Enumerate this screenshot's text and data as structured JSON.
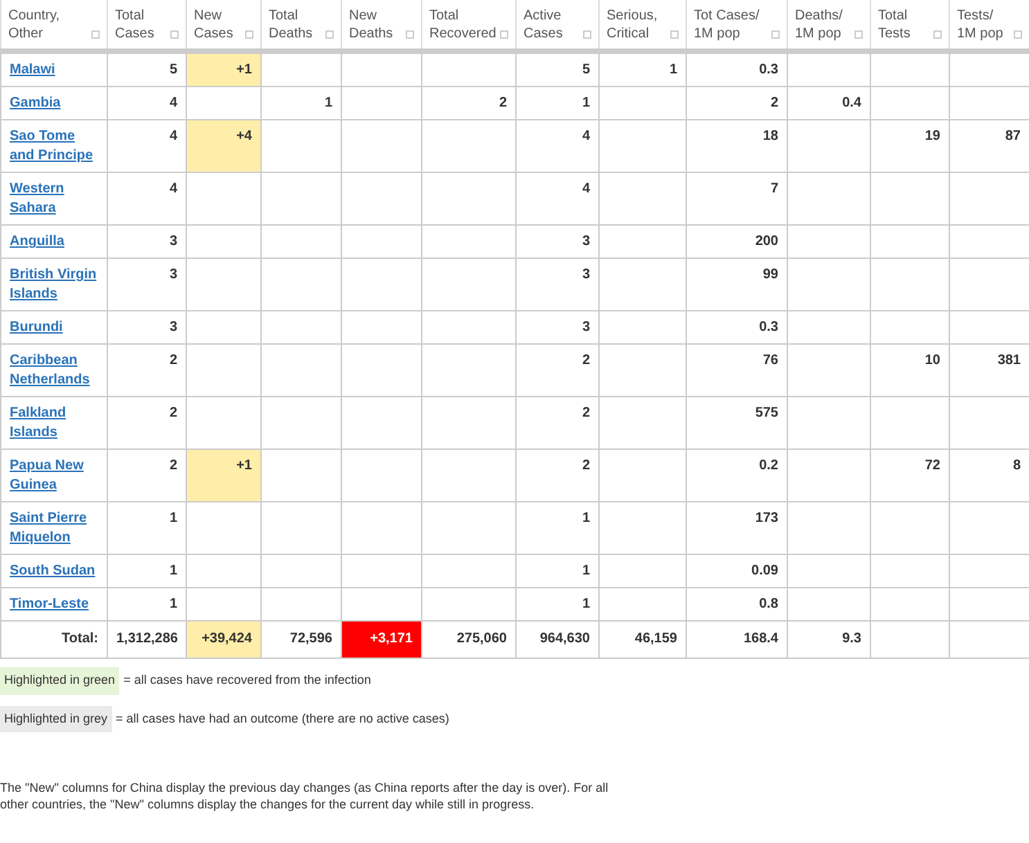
{
  "table": {
    "columns": [
      {
        "label": "Country, Other",
        "kind": "country"
      },
      {
        "label": "Total Cases",
        "kind": "number"
      },
      {
        "label": "New Cases",
        "kind": "new_cases"
      },
      {
        "label": "Total Deaths",
        "kind": "number"
      },
      {
        "label": "New Deaths",
        "kind": "new_deaths"
      },
      {
        "label": "Total Recovered",
        "kind": "number"
      },
      {
        "label": "Active Cases",
        "kind": "number"
      },
      {
        "label": "Serious, Critical",
        "kind": "number"
      },
      {
        "label": "Tot Cases/ 1M pop",
        "kind": "number"
      },
      {
        "label": "Deaths/ 1M pop",
        "kind": "number"
      },
      {
        "label": "Total Tests",
        "kind": "number"
      },
      {
        "label": "Tests/ 1M pop",
        "kind": "number"
      }
    ],
    "rows": [
      {
        "cells": [
          "Malawi",
          "5",
          "+1",
          "",
          "",
          "",
          "5",
          "1",
          "0.3",
          "",
          "",
          ""
        ]
      },
      {
        "cells": [
          "Gambia",
          "4",
          "",
          "1",
          "",
          "2",
          "1",
          "",
          "2",
          "0.4",
          "",
          ""
        ]
      },
      {
        "cells": [
          "Sao Tome and Principe",
          "4",
          "+4",
          "",
          "",
          "",
          "4",
          "",
          "18",
          "",
          "19",
          "87"
        ]
      },
      {
        "cells": [
          "Western Sahara",
          "4",
          "",
          "",
          "",
          "",
          "4",
          "",
          "7",
          "",
          "",
          ""
        ]
      },
      {
        "cells": [
          "Anguilla",
          "3",
          "",
          "",
          "",
          "",
          "3",
          "",
          "200",
          "",
          "",
          ""
        ]
      },
      {
        "cells": [
          "British Virgin Islands",
          "3",
          "",
          "",
          "",
          "",
          "3",
          "",
          "99",
          "",
          "",
          ""
        ]
      },
      {
        "cells": [
          "Burundi",
          "3",
          "",
          "",
          "",
          "",
          "3",
          "",
          "0.3",
          "",
          "",
          ""
        ]
      },
      {
        "cells": [
          "Caribbean Netherlands",
          "2",
          "",
          "",
          "",
          "",
          "2",
          "",
          "76",
          "",
          "10",
          "381"
        ]
      },
      {
        "cells": [
          "Falkland Islands",
          "2",
          "",
          "",
          "",
          "",
          "2",
          "",
          "575",
          "",
          "",
          ""
        ]
      },
      {
        "cells": [
          "Papua New Guinea",
          "2",
          "+1",
          "",
          "",
          "",
          "2",
          "",
          "0.2",
          "",
          "72",
          "8"
        ]
      },
      {
        "cells": [
          "Saint Pierre Miquelon",
          "1",
          "",
          "",
          "",
          "",
          "1",
          "",
          "173",
          "",
          "",
          ""
        ]
      },
      {
        "cells": [
          "South Sudan",
          "1",
          "",
          "",
          "",
          "",
          "1",
          "",
          "0.09",
          "",
          "",
          ""
        ]
      },
      {
        "cells": [
          "Timor-Leste",
          "1",
          "",
          "",
          "",
          "",
          "1",
          "",
          "0.8",
          "",
          "",
          ""
        ]
      },
      {
        "kind": "total",
        "cells": [
          "Total:",
          "1,312,286",
          "+39,424",
          "72,596",
          "+3,171",
          "275,060",
          "964,630",
          "46,159",
          "168.4",
          "9.3",
          "",
          ""
        ]
      }
    ]
  },
  "legend": [
    {
      "label": "Highlighted in green",
      "color": "#e6f4d7",
      "text": "= all cases have recovered from the infection"
    },
    {
      "label": "Highlighted in grey",
      "color": "#eaeaea",
      "text": "= all cases have had an outcome (there are no active cases)"
    }
  ],
  "note": "The \"New\" columns for China display the previous day changes (as China reports after the day is over). For all other countries, the \"New\" columns display the changes for the current day while still in progress."
}
